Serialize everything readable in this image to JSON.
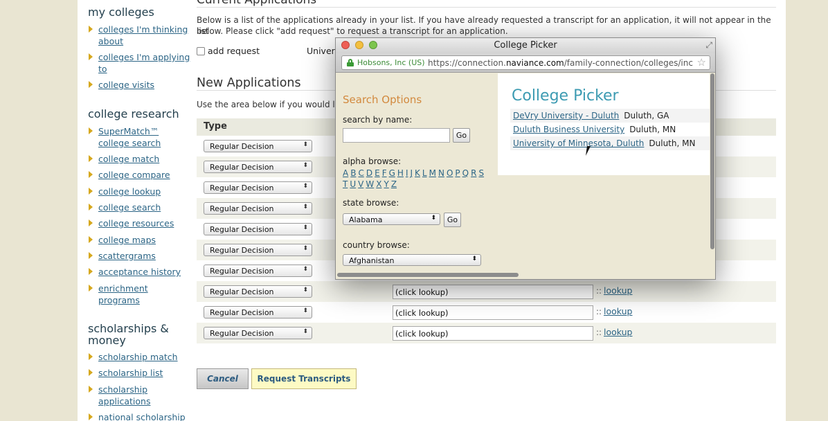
{
  "sidebar": {
    "sections": [
      {
        "heading": "my colleges",
        "items": [
          "colleges I'm thinking about",
          "colleges I'm applying to",
          "college visits"
        ]
      },
      {
        "heading": "college research",
        "items": [
          "SuperMatch™ college search",
          "college match",
          "college compare",
          "college lookup",
          "college search",
          "college resources",
          "college maps",
          "scattergrams",
          "acceptance history",
          "enrichment programs"
        ]
      },
      {
        "heading": "scholarships & money",
        "items": [
          "scholarship match",
          "scholarship list",
          "scholarship applications",
          "national scholarship"
        ]
      }
    ]
  },
  "main": {
    "current_heading": "Current Applications",
    "current_text_1": "Below is a list of the applications already in your list. If you have already requested a transcript for an application, it will not appear in the list",
    "current_text_2": "below. Please click \"add request\" to request a transcript for an application.",
    "add_request_label": "add request",
    "university_col": "Univers",
    "new_heading": "New Applications",
    "new_text": "Use the area below if you would lik",
    "type_header": "Type",
    "decision_value": "Regular Decision",
    "lookup_placeholder": "(click lookup)",
    "lookup_sep": "::",
    "lookup_link": "lookup",
    "cancel_label": "Cancel",
    "request_label": "Request Transcripts"
  },
  "popup": {
    "window_title": "College Picker",
    "site_identity": "Hobsons, Inc (US)",
    "url_prefix": "https://connection.",
    "url_domain": "naviance.com",
    "url_suffix": "/family-connection/colleges/inc",
    "search_options_title": "Search Options",
    "search_by_name_label": "search by name:",
    "go_label": "Go",
    "alpha_label": "alpha browse:",
    "letters": [
      "A",
      "B",
      "C",
      "D",
      "E",
      "F",
      "G",
      "H",
      "I",
      "J",
      "K",
      "L",
      "M",
      "N",
      "O",
      "P",
      "Q",
      "R",
      "S",
      "T",
      "U",
      "V",
      "W",
      "X",
      "Y",
      "Z"
    ],
    "state_label": "state browse:",
    "state_value": "Alabama",
    "country_label": "country browse:",
    "country_value": "Afghanistan",
    "picker_title": "College Picker",
    "results": [
      {
        "name": "DeVry University - Duluth",
        "location": "Duluth, GA"
      },
      {
        "name": "Duluth Business University",
        "location": "Duluth, MN"
      },
      {
        "name": "University of Minnesota, Duluth",
        "location": "Duluth, MN"
      }
    ]
  },
  "colors": {
    "background": "#e9e5d2",
    "link": "#2c6586",
    "accent_orange": "#d2893e",
    "accent_teal": "#3d9bb2",
    "bullet": "#d6a81e"
  }
}
